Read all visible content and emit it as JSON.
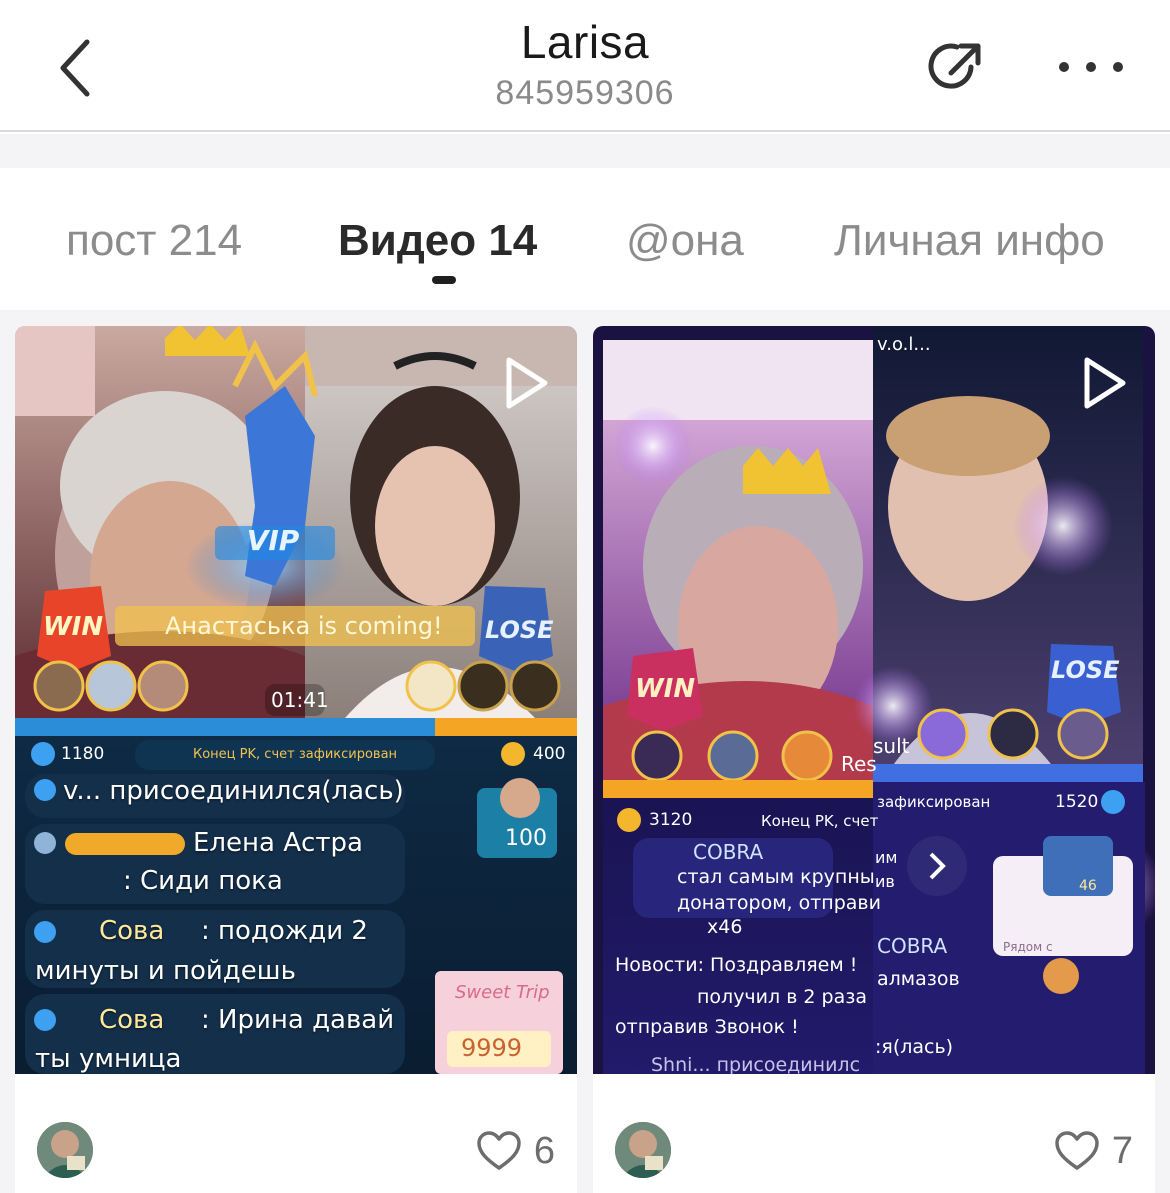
{
  "header": {
    "title": "Larisa",
    "user_id": "845959306",
    "back_icon": "chevron-left-icon",
    "share_icon": "share-arrow-icon",
    "more_icon": "more-dots-icon"
  },
  "tabs": [
    {
      "label": "пост 214",
      "active": false
    },
    {
      "label": "Видео 14",
      "active": true
    },
    {
      "label": "@она",
      "active": false
    },
    {
      "label": "Личная инфо",
      "active": false
    }
  ],
  "videos": [
    {
      "likes": "6",
      "overlay": {
        "timer": "01:41",
        "score_left": "1180",
        "score_right": "400",
        "status": "Конец PK, счет зафиксирован",
        "win": "WIN",
        "lose": "LOSE",
        "vip": "VIP",
        "coming": "Анастаська  is coming!",
        "gift_value": "100",
        "sweet_trip": "Sweet Trip",
        "sweet_amount": "9999",
        "chat": [
          "v... присоединился(лась)",
          "Елена Астра",
          ": Сиди пока",
          "Сова",
          ": подожди 2",
          "минуты и пойдешь",
          "Сова",
          ": Ирина давай",
          "ты умница"
        ]
      }
    },
    {
      "likes": "7",
      "overlay": {
        "top_name": "v.o.l...",
        "win": "WIN",
        "lose": "LOSE",
        "result": "Res",
        "result2": "sult",
        "score_left": "3120",
        "score_right": "1520",
        "status_left": "Конец PK, счет",
        "status_right": "зафиксирован",
        "cobra": "COBRA",
        "chat": [
          "стал самым крупны",
          "донатором, отправи",
          "x46",
          "Новости: Поздравляем !",
          "получил в 2 раза",
          "отправив Звонок !",
          "Shni... присоединилс"
        ],
        "side_text": [
          "им",
          "ив",
          "COBRA",
          "алмазов",
          ":я(лась)"
        ],
        "gift_count": "46",
        "near": "Рядом с"
      }
    }
  ],
  "colors": {
    "tab_active": "#2a2a2a",
    "tab_inactive": "#8c8c8c",
    "background": "#f4f4f6",
    "pk_blue": "#2b8cd8",
    "pk_orange": "#f5a524"
  }
}
